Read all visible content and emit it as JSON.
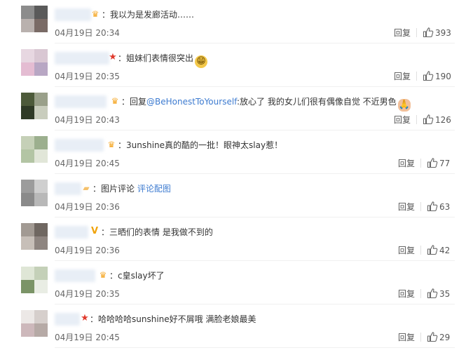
{
  "labels": {
    "reply": "回复"
  },
  "comments": [
    {
      "badge": "crown",
      "text": "：我以为是发廊活动……",
      "time": "04月19日 20:34",
      "likes": "393"
    },
    {
      "badge": "star",
      "text": "：姐妹们表情很突出",
      "emoji": "😁",
      "time": "04月19日 20:35",
      "likes": "190"
    },
    {
      "badge": "crown",
      "text_pre": "：回复",
      "mention": "@BeHonestToYourself",
      "text_post": ":放心了 我的女儿们很有偶像自觉 不近男色",
      "emoji": "🙏",
      "time": "04月19日 20:43",
      "likes": "126"
    },
    {
      "badge": "crown",
      "text": "：3unshine真的酷的一批！眼神太slay惹！",
      "time": "04月19日 20:45",
      "likes": "77"
    },
    {
      "badge": "card",
      "text_pre": "：图片评论 ",
      "link": "评论配图",
      "time": "04月19日 20:36",
      "likes": "63"
    },
    {
      "badge": "vip",
      "text": "：三晒们的表情 是我做不到的",
      "time": "04月19日 20:36",
      "likes": "42"
    },
    {
      "badge": "crown",
      "text": "：c皇slay坏了",
      "time": "04月19日 20:35",
      "likes": "35"
    },
    {
      "badge": "star",
      "text": "：哈哈哈哈sunshine好不屑哦 满脸老娘最美",
      "time": "04月19日 20:45",
      "likes": "29"
    }
  ],
  "colors": {
    "link": "#3d7bd0",
    "text": "#333333",
    "muted": "#666666"
  }
}
